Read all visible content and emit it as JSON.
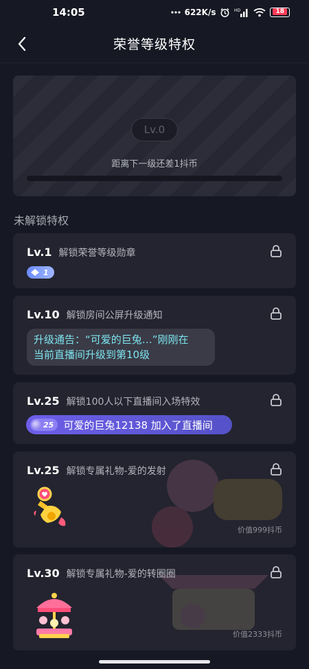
{
  "status": {
    "time": "14:05",
    "speed": "622K/s",
    "network": "HD",
    "battery": "18"
  },
  "nav": {
    "title": "荣誉等级特权"
  },
  "level": {
    "badge": "Lv.0",
    "subtitle": "距离下一级还差1抖币",
    "progress": 0
  },
  "section": {
    "title": "未解锁特权"
  },
  "privileges": [
    {
      "level": "Lv.1",
      "desc": "解锁荣誉等级勋章",
      "badge_num": "1"
    },
    {
      "level": "Lv.10",
      "desc": "解锁房间公屏升级通知",
      "notice_line1": "升级通告：“可爱的巨兔…”刚刚在",
      "notice_line2": "当前直播间升级到第10级"
    },
    {
      "level": "Lv.25",
      "desc": "解锁100人以下直播间入场特效",
      "chip_num": "25",
      "enter_text": "可爱的巨兔12138 加入了直播间"
    },
    {
      "level": "Lv.25",
      "desc": "解锁专属礼物-爱的发射",
      "price": "价值999抖币"
    },
    {
      "level": "Lv.30",
      "desc": "解锁专属礼物-爱的转圈圈",
      "price": "价值2333抖币"
    }
  ],
  "colors": {
    "background": "#161823",
    "card": "#23242f",
    "notice_text": "#7de3ee",
    "enter_pill": "#6d5ee8"
  }
}
